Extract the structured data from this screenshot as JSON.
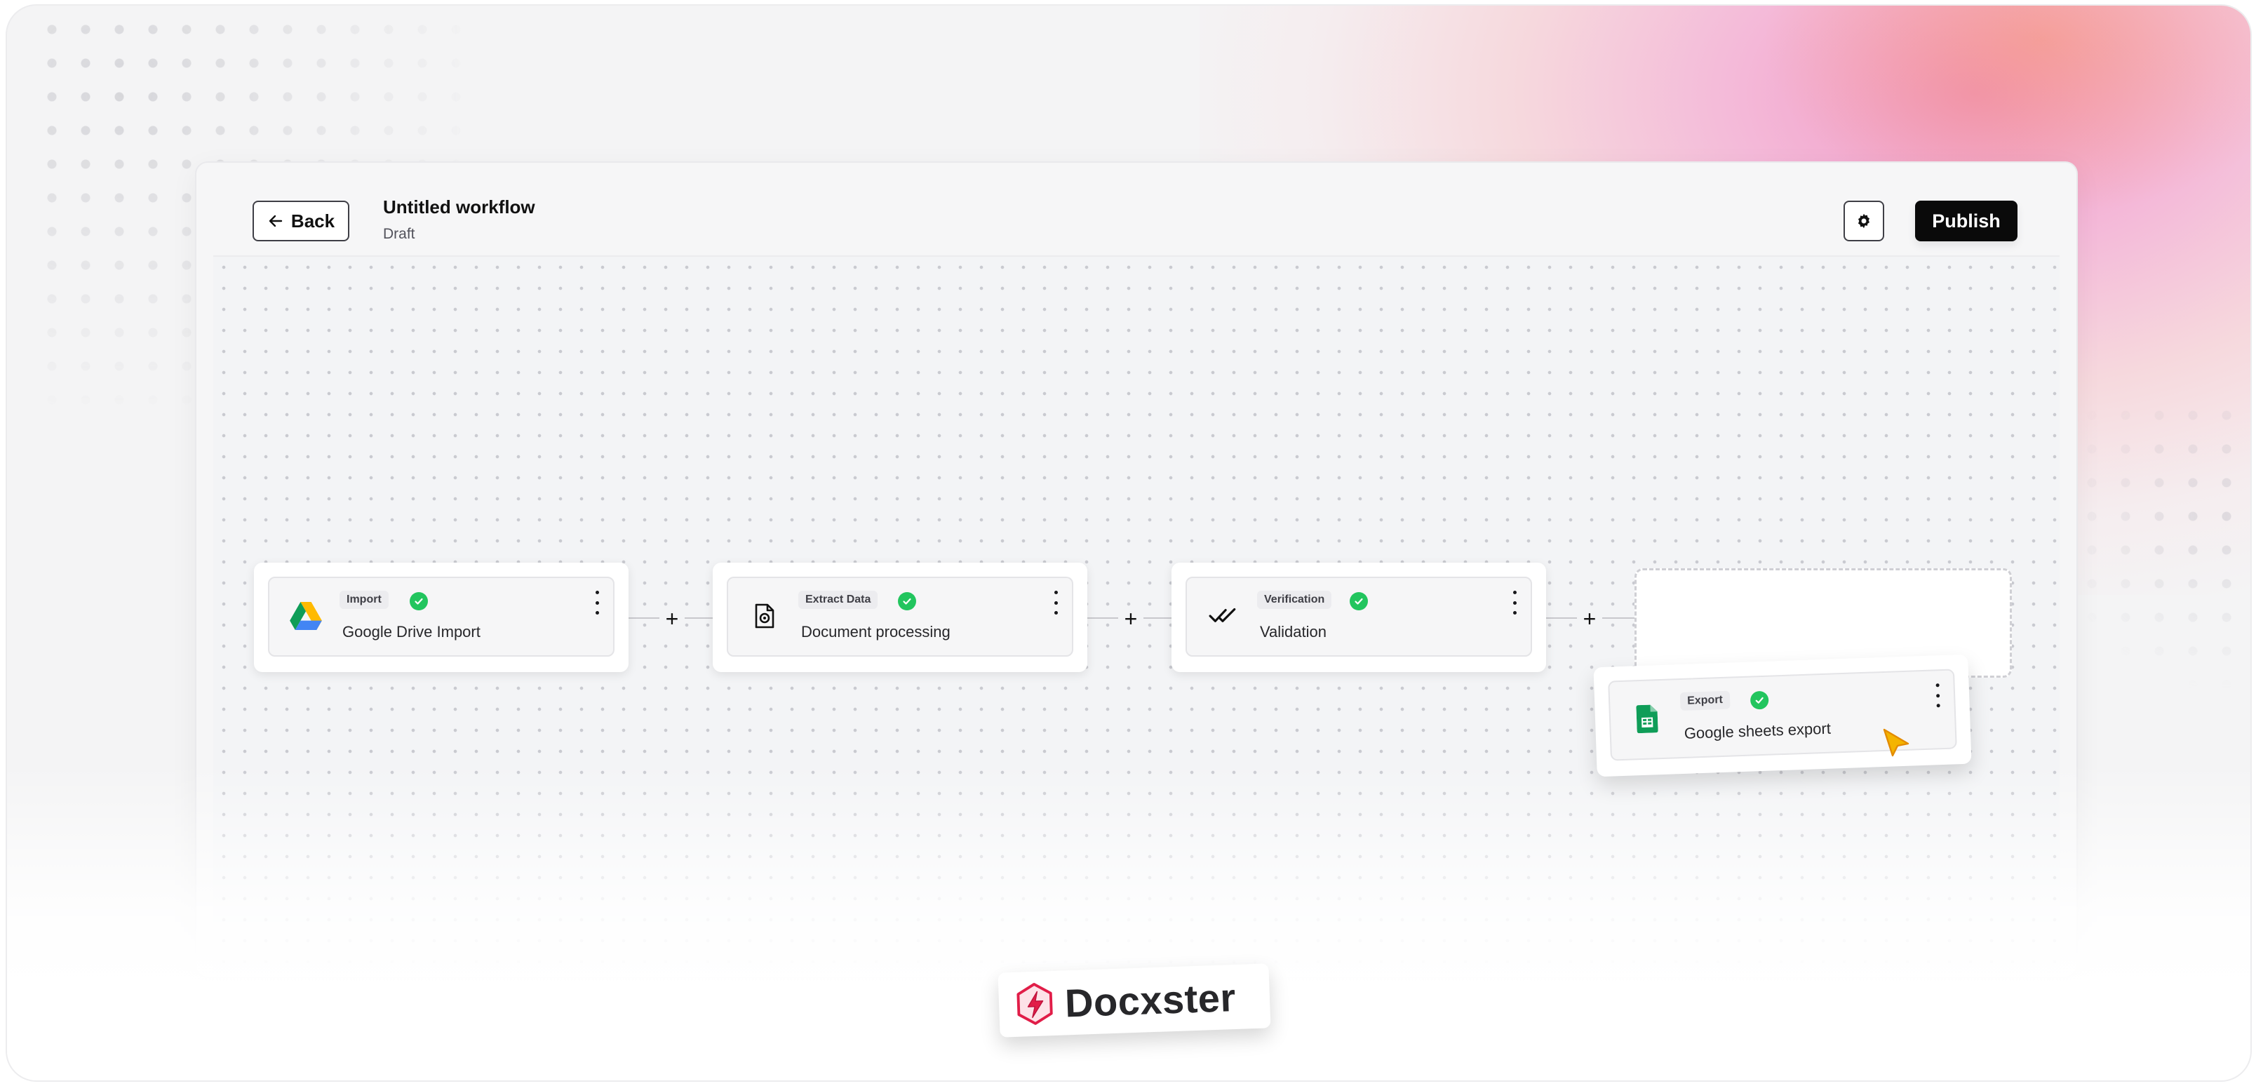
{
  "workflow": {
    "back_label": "Back",
    "title": "Untitled workflow",
    "status": "Draft",
    "publish_label": "Publish"
  },
  "nodes": [
    {
      "tag": "Import",
      "name": "Google Drive Import",
      "icon": "google-drive-icon"
    },
    {
      "tag": "Extract Data",
      "name": "Document processing",
      "icon": "document-settings-icon"
    },
    {
      "tag": "Verification",
      "name": "Validation",
      "icon": "double-check-icon"
    },
    {
      "tag": "Export",
      "name": "Google sheets export",
      "icon": "google-sheets-icon"
    }
  ],
  "connector_label": "+",
  "brand": {
    "name": "Docxster"
  },
  "colors": {
    "accent": "#0a0a0a",
    "success": "#22c55e",
    "brand": "#e11d48"
  }
}
